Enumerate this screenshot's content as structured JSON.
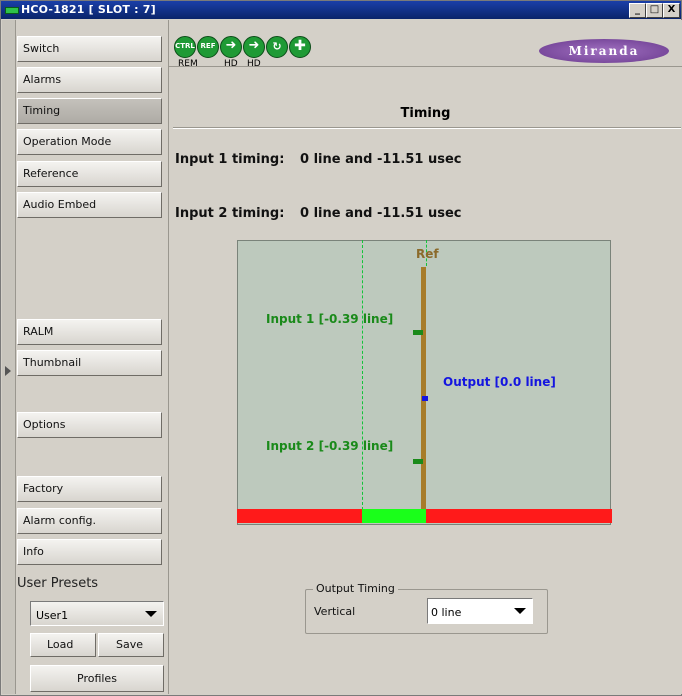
{
  "window": {
    "title": "HCO-1821 [ SLOT : 7]",
    "buttons": [
      "_",
      "□",
      "X"
    ]
  },
  "sidebar": {
    "items": [
      {
        "label": "Switch"
      },
      {
        "label": "Alarms"
      },
      {
        "label": "Timing",
        "active": true
      },
      {
        "label": "Operation Mode"
      },
      {
        "label": "Reference"
      },
      {
        "label": "Audio Embed"
      },
      {
        "label": "RALM"
      },
      {
        "label": "Thumbnail"
      },
      {
        "label": "Options"
      },
      {
        "label": "Factory"
      },
      {
        "label": "Alarm config."
      },
      {
        "label": "Info"
      }
    ],
    "presets_label": "User Presets",
    "preset_selected": "User1",
    "load_label": "Load",
    "save_label": "Save",
    "profiles_label": "Profiles"
  },
  "toolbar": {
    "icons": [
      {
        "name": "ctrl-icon",
        "text": "CTRL",
        "caption": "REM"
      },
      {
        "name": "ref-icon",
        "text": "REF",
        "caption": ""
      },
      {
        "name": "hd-input-1-icon",
        "text": "",
        "caption": "HD"
      },
      {
        "name": "hd-input-2-icon",
        "text": "",
        "caption": "HD"
      },
      {
        "name": "output-icon",
        "text": "",
        "caption": ""
      },
      {
        "name": "plus-icon",
        "text": "",
        "caption": ""
      }
    ],
    "logo": "Miranda"
  },
  "main": {
    "title": "Timing",
    "input1_label": "Input 1 timing:",
    "input1_value": "0 line and -11.51 usec",
    "input2_label": "Input 2 timing:",
    "input2_value": "0 line and -11.51 usec"
  },
  "diagram": {
    "ref_label": "Ref",
    "input1_label": "Input 1 [-0.39 line]",
    "input2_label": "Input 2 [-0.39 line]",
    "output_label": "Output [0.0 line]",
    "colors": {
      "ref": "#a77c2a",
      "input": "#1a8a1a",
      "output": "#1414e0",
      "bar_red": "#ff1a1a",
      "bar_green": "#1aff1a"
    }
  },
  "output_timing": {
    "group_label": "Output Timing",
    "vertical_label": "Vertical",
    "vertical_value": "0 line"
  }
}
